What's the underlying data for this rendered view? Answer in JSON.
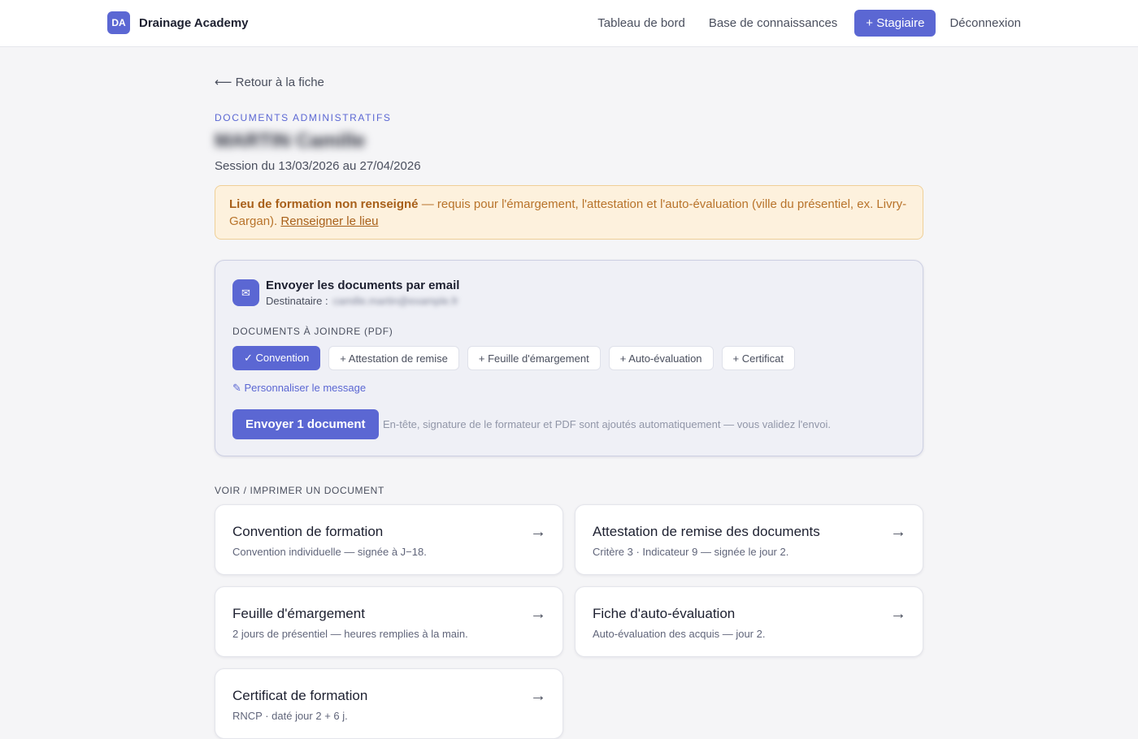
{
  "header": {
    "logo": "DA",
    "brand": "Drainage Academy",
    "nav": {
      "dashboard": "Tableau de bord",
      "knowledge": "Base de connaissances",
      "new_trainee": "+ Stagiaire",
      "logout": "Déconnexion"
    }
  },
  "page": {
    "back": "⟵ Retour à la fiche",
    "eyebrow": "DOCUMENTS ADMINISTRATIFS",
    "trainee_name": "MARTIN Camille",
    "session": "Session du 13/03/2026 au 27/04/2026"
  },
  "alert": {
    "strong": "Lieu de formation non renseigné",
    "text": " — requis pour l'émargement, l'attestation et l'auto-évaluation (ville du présentiel, ex. Livry-Gargan). ",
    "link": "Renseigner le lieu"
  },
  "email": {
    "icon": "mail-icon",
    "icon_glyph": "✉",
    "title": "Envoyer les documents par email",
    "recipient_label": "Destinataire :",
    "recipient_value": "camille.martin@example.fr",
    "attach_label": "DOCUMENTS À JOINDRE (PDF)",
    "chips": [
      {
        "label": "✓ Convention",
        "selected": true
      },
      {
        "label": "+ Attestation de remise",
        "selected": false
      },
      {
        "label": "+ Feuille d'émargement",
        "selected": false
      },
      {
        "label": "+ Auto-évaluation",
        "selected": false
      },
      {
        "label": "+ Certificat",
        "selected": false
      }
    ],
    "customize": "✎ Personnaliser le message",
    "send": "Envoyer 1 document",
    "note": "En-tête, signature de le formateur et PDF sont ajoutés automatiquement — vous validez l'envoi."
  },
  "documents": {
    "label": "VOIR / IMPRIMER UN DOCUMENT",
    "arrow": "→",
    "items": [
      {
        "title": "Convention de formation",
        "subtitle": "Convention individuelle — signée à J−18."
      },
      {
        "title": "Attestation de remise des documents",
        "subtitle": "Critère 3 · Indicateur 9 — signée le jour 2."
      },
      {
        "title": "Feuille d'émargement",
        "subtitle": "2 jours de présentiel — heures remplies à la main."
      },
      {
        "title": "Fiche d'auto-évaluation",
        "subtitle": "Auto-évaluation des acquis — jour 2."
      },
      {
        "title": "Certificat de formation",
        "subtitle": "RNCP · daté jour 2 + 6 j."
      }
    ]
  },
  "colors": {
    "accent": "#5b67d3",
    "warning_bg": "#fdf1dd",
    "warning_text": "#b8732a",
    "page_bg": "#f5f5f7"
  }
}
